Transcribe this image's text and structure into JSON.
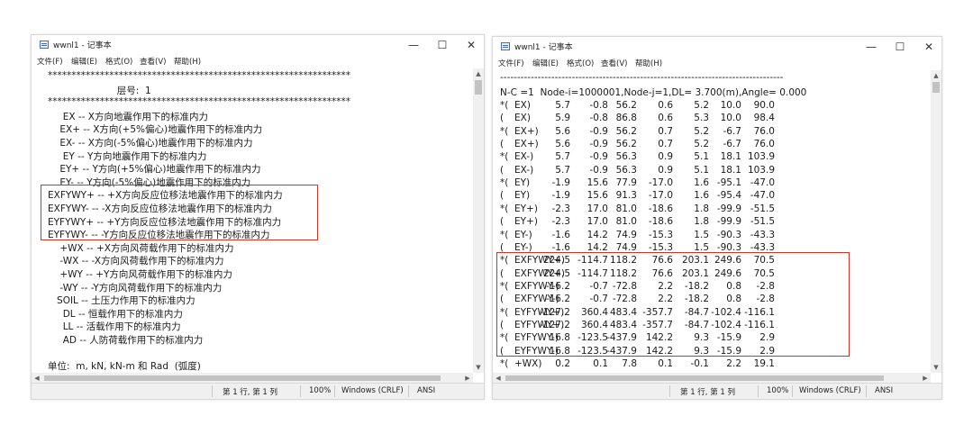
{
  "windows": [
    {
      "title": "wwnl1 - 记事本",
      "menu": [
        "文件(F)",
        "编辑(E)",
        "格式(O)",
        "查看(V)",
        "帮助(H)"
      ],
      "lines": [
        "   ****************************************************************",
        "                          层号:  1",
        "   ****************************************************************",
        "        EX -- X方向地震作用下的标准内力",
        "       EX+ -- X方向(+5%偏心)地震作用下的标准内力",
        "       EX- -- X方向(-5%偏心)地震作用下的标准内力",
        "        EY -- Y方向地震作用下的标准内力",
        "       EY+ -- Y方向(+5%偏心)地震作用下的标准内力",
        "       EY- -- Y方向(-5%偏心)地震作用下的标准内力",
        "   EXFYWY+ -- +X方向反应位移法地震作用下的标准内力",
        "   EXFYWY- -- -X方向反应位移法地震作用下的标准内力",
        "   EYFYWY+ -- +Y方向反应位移法地震作用下的标准内力",
        "   EYFYWY- -- -Y方向反应位移法地震作用下的标准内力",
        "       +WX -- +X方向风荷载作用下的标准内力",
        "       -WX -- -X方向风荷载作用下的标准内力",
        "       +WY -- +Y方向风荷载作用下的标准内力",
        "       -WY -- -Y方向风荷载作用下的标准内力",
        "      SOIL -- 土压力作用下的标准内力",
        "        DL -- 恒载作用下的标准内力",
        "        LL -- 活载作用下的标准内力",
        "        AD -- 人防荷载作用下的标准内力",
        "",
        "   单位:  m, kN, kN-m 和 Rad  (弧度)"
      ],
      "status": {
        "position": "第 1 行, 第 1 列",
        "zoom": "100%",
        "eol": "Windows (CRLF)",
        "encoding": "ANSI"
      }
    },
    {
      "title": "wwnl1 - 记事本",
      "menu": [
        "文件(F)",
        "编辑(E)",
        "格式(O)",
        "查看(V)",
        "帮助(H)"
      ],
      "dash_line": "-----------------------------------------------------------------------------------",
      "header": "N-C =1  Node-i=1000001,Node-j=1,DL= 3.700(m),Angle= 0.000",
      "rows": [
        [
          "*(",
          "EX)",
          "5.7",
          "-0.8",
          "56.2",
          "0.6",
          "5.2",
          "10.0",
          "90.0"
        ],
        [
          "(",
          "EX)",
          "5.9",
          "-0.8",
          "86.8",
          "0.6",
          "5.3",
          "10.0",
          "98.4"
        ],
        [
          "*(",
          "EX+)",
          "5.6",
          "-0.9",
          "56.2",
          "0.7",
          "5.2",
          "-6.7",
          "76.0"
        ],
        [
          "(",
          "EX+)",
          "5.6",
          "-0.9",
          "56.2",
          "0.7",
          "5.2",
          "-6.7",
          "76.0"
        ],
        [
          "*(",
          "EX-)",
          "5.7",
          "-0.9",
          "56.3",
          "0.9",
          "5.1",
          "18.1",
          "103.9"
        ],
        [
          "(",
          "EX-)",
          "5.7",
          "-0.9",
          "56.3",
          "0.9",
          "5.1",
          "18.1",
          "103.9"
        ],
        [
          "*(",
          "EY)",
          "-1.9",
          "15.6",
          "77.9",
          "-17.0",
          "1.6",
          "-95.1",
          "-47.0"
        ],
        [
          "(",
          "EY)",
          "-1.9",
          "15.6",
          "91.3",
          "-17.0",
          "1.6",
          "-95.4",
          "-47.0"
        ],
        [
          "*(",
          "EY+)",
          "-2.3",
          "17.0",
          "81.0",
          "-18.6",
          "1.8",
          "-99.9",
          "-51.5"
        ],
        [
          "(",
          "EY+)",
          "-2.3",
          "17.0",
          "81.0",
          "-18.6",
          "1.8",
          "-99.9",
          "-51.5"
        ],
        [
          "*(",
          "EY-)",
          "-1.6",
          "14.2",
          "74.9",
          "-15.3",
          "1.5",
          "-90.3",
          "-43.3"
        ],
        [
          "(",
          "EY-)",
          "-1.6",
          "14.2",
          "74.9",
          "-15.3",
          "1.5",
          "-90.3",
          "-43.3"
        ],
        [
          "*(",
          "EXFYWY+)",
          "224.5",
          "-114.7",
          "118.2",
          "76.6",
          "203.1",
          "249.6",
          "70.5"
        ],
        [
          "(",
          "EXFYWY+)",
          "224.5",
          "-114.7",
          "118.2",
          "76.6",
          "203.1",
          "249.6",
          "70.5"
        ],
        [
          "*(",
          "EXFYWY-)",
          "-16.2",
          "-0.7",
          "-72.8",
          "2.2",
          "-18.2",
          "0.8",
          "-2.8"
        ],
        [
          "(",
          "EXFYWY-)",
          "-16.2",
          "-0.7",
          "-72.8",
          "2.2",
          "-18.2",
          "0.8",
          "-2.8"
        ],
        [
          "*(",
          "EYFYWY+)",
          "-127.2",
          "360.4",
          "483.4",
          "-357.7",
          "-84.7",
          "-102.4",
          "-116.1"
        ],
        [
          "(",
          "EYFYWY+)",
          "-127.2",
          "360.4",
          "483.4",
          "-357.7",
          "-84.7",
          "-102.4",
          "-116.1"
        ],
        [
          "*(",
          "EYFYWY-)",
          "16.8",
          "-123.5",
          "-437.9",
          "142.2",
          "9.3",
          "-15.9",
          "2.9"
        ],
        [
          "(",
          "EYFYWY-)",
          "16.8",
          "-123.5",
          "-437.9",
          "142.2",
          "9.3",
          "-15.9",
          "2.9"
        ],
        [
          "*(",
          "+WX)",
          "0.2",
          "0.1",
          "7.8",
          "0.1",
          "-0.1",
          "2.2",
          "19.1"
        ]
      ],
      "status": {
        "position": "第 1 行, 第 1 列",
        "zoom": "100%",
        "eol": "Windows (CRLF)",
        "encoding": "ANSI"
      }
    }
  ],
  "window_controls": {
    "minimize": "—",
    "maximize": "☐",
    "close": "✕"
  },
  "highlight_color": "#c0392b"
}
